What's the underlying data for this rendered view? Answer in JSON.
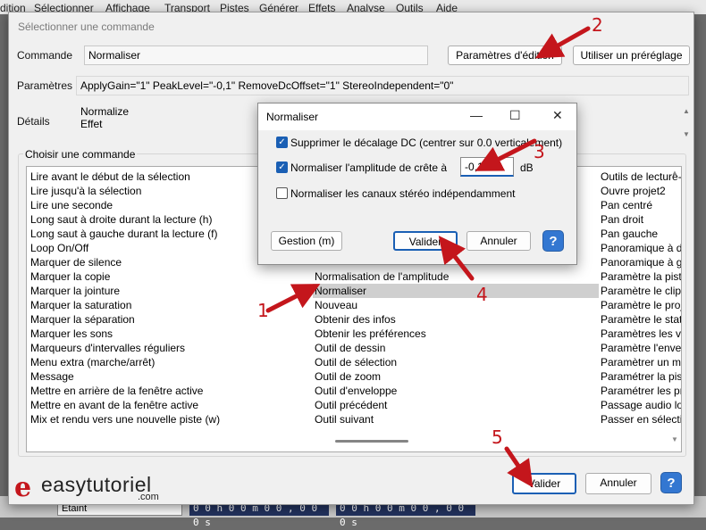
{
  "background": {
    "menu": [
      "dition",
      "Sélectionner",
      "Affichage",
      "Transport",
      "Pistes",
      "Générer",
      "Effets",
      "Analyse",
      "Outils",
      "Aide"
    ],
    "bottom_field_left": "Etaint",
    "bottom_timer_1": "0 0 h 0 0 m 0 0 , 0 0 0 s",
    "bottom_timer_2": "0 0 h 0 0 m 0 0 , 0 0 0 s"
  },
  "main_dialog": {
    "title": "Sélectionner une commande",
    "command_label": "Commande",
    "command_value": "Normaliser",
    "edit_params_button": "Paramètres d'édition",
    "use_preset_button": "Utiliser un préréglage",
    "params_label": "Paramètres",
    "params_value": "ApplyGain=\"1\" PeakLevel=\"-0,1\" RemoveDcOffset=\"1\" StereoIndependent=\"0\"",
    "details_label": "Détails",
    "details_line1": "Normalize",
    "details_line2": "Effet",
    "choose_group_title": "Choisir une commande",
    "list_col1": [
      "Lire avant le début de la sélection",
      "Lire jusqu'à la sélection",
      "Lire une seconde",
      "Long saut à droite durant la lecture (h)",
      "Long saut à gauche durant la lecture (f)",
      "Loop On/Off",
      "Marquer de silence",
      "Marquer la copie",
      "Marquer la jointure",
      "Marquer la saturation",
      "Marquer la séparation",
      "Marquer les sons",
      "Marqueurs d'intervalles réguliers",
      "Menu extra (marche/arrêt)",
      "Message",
      "Mettre en arrière de la fenêtre active",
      "Mettre en avant de la fenêtre active",
      "Mix et rendu vers une nouvelle piste (w)"
    ],
    "list_col2": [
      "",
      "",
      "",
      "",
      "",
      "",
      "",
      "Normalisation de l'amplitude",
      "Normaliser",
      "Nouveau",
      "Obtenir des infos",
      "Obtenir les préférences",
      "Outil de dessin",
      "Outil de sélection",
      "Outil de zoom",
      "Outil d'enveloppe",
      "Outil précédent",
      "Outil suivant"
    ],
    "list_col3": [
      "Outils de lecture-",
      "Ouvre projet2",
      "Pan centré",
      "Pan droit",
      "Pan gauche",
      "Panoramique à d",
      "Panoramique à g",
      "Paramètre la pist",
      "Paramètre le clip",
      "Paramètre le proj",
      "Paramètre le stat",
      "Paramètres les vis",
      "Paramètre l'envel",
      "Paramètrer un ma",
      "Paramétrer la pist",
      "Paramétrer les pr",
      "Passage audio log",
      "Passer en sélecti"
    ],
    "selected_index": 8,
    "ok_button": "Valider",
    "cancel_button": "Annuler",
    "help_button": "?"
  },
  "logo": {
    "mark": "e",
    "name": "easytutoriel",
    "suffix": ".com"
  },
  "normalize_dialog": {
    "title": "Normaliser",
    "minimize": "—",
    "maximize": "☐",
    "close": "✕",
    "dc_offset_label": "Supprimer le décalage DC (centrer sur 0.0 verticalement)",
    "dc_offset_checked": true,
    "peak_label": "Normaliser l'amplitude de crête à",
    "peak_checked": true,
    "peak_value": "-0,1",
    "peak_unit": "dB",
    "stereo_label": "Normaliser les canaux stéréo indépendamment",
    "stereo_checked": false,
    "manage_button": "Gestion (m)",
    "ok_button": "Valider",
    "cancel_button": "Annuler",
    "help_button": "?"
  },
  "annotations": {
    "colors": {
      "arrow": "#c4161c"
    },
    "n1": "1",
    "n2": "2",
    "n3": "3",
    "n4": "4",
    "n5": "5"
  }
}
